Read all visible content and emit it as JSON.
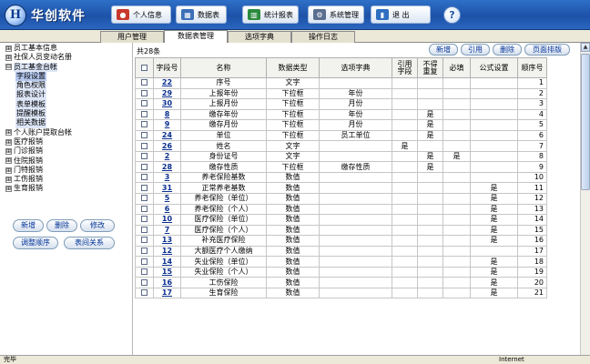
{
  "app": {
    "logo_char": "H",
    "name": "华创软件"
  },
  "header_buttons": [
    {
      "label": "个人信息",
      "icon": "person-icon"
    },
    {
      "label": "数据表",
      "icon": "table-icon"
    },
    {
      "label": "统计报表",
      "icon": "chart-icon"
    },
    {
      "label": "系统管理",
      "icon": "gear-icon"
    },
    {
      "label": "退 出",
      "icon": "exit-icon"
    }
  ],
  "help_label": "?",
  "tabs": [
    {
      "label": "用户管理",
      "active": false
    },
    {
      "label": "数据表管理",
      "active": true
    },
    {
      "label": "选项字典",
      "active": false
    },
    {
      "label": "操作日志",
      "active": false
    }
  ],
  "tree": [
    {
      "label": "员工基本信息",
      "expander": "⊞",
      "level": 0
    },
    {
      "label": "社保人员变动名册",
      "expander": "⊞",
      "level": 0
    },
    {
      "label": "员工基金台帐",
      "expander": "⊟",
      "level": 0
    },
    {
      "label": "字段设置",
      "level": 1,
      "selected": true
    },
    {
      "label": "角色权限",
      "level": 1
    },
    {
      "label": "报表设计",
      "level": 1
    },
    {
      "label": "表单模板",
      "level": 1
    },
    {
      "label": "提醒模板",
      "level": 1
    },
    {
      "label": "相关数据",
      "level": 1
    },
    {
      "label": "个人账户提取台帐",
      "expander": "⊞",
      "level": 0
    },
    {
      "label": "医疗报销",
      "expander": "⊞",
      "level": 0
    },
    {
      "label": "门诊报销",
      "expander": "⊞",
      "level": 0
    },
    {
      "label": "住院报销",
      "expander": "⊞",
      "level": 0
    },
    {
      "label": "门特报销",
      "expander": "⊞",
      "level": 0
    },
    {
      "label": "工伤报销",
      "expander": "⊞",
      "level": 0
    },
    {
      "label": "生育报销",
      "expander": "⊞",
      "level": 0
    }
  ],
  "sidebar_buttons": {
    "add": "新增",
    "delete": "删除",
    "edit": "修改",
    "reorder": "调整顺序",
    "relations": "表间关系"
  },
  "main": {
    "count_text": "共28条",
    "actions": {
      "add": "新增",
      "reference": "引用",
      "delete": "删除",
      "sort": "页面排版"
    },
    "columns": [
      "",
      "字段号",
      "名称",
      "数据类型",
      "选项字典",
      "引用\n字段",
      "不得\n重复",
      "必填",
      "公式设置",
      "顺序号"
    ],
    "rows": [
      {
        "id": "22",
        "name": "序号",
        "type": "文字",
        "dict": "",
        "ref": "",
        "unique": "",
        "req": "",
        "formula": "",
        "order": "1"
      },
      {
        "id": "29",
        "name": "上报年份",
        "type": "下拉框",
        "dict": "年份",
        "ref": "",
        "unique": "",
        "req": "",
        "formula": "",
        "order": "2"
      },
      {
        "id": "30",
        "name": "上报月份",
        "type": "下拉框",
        "dict": "月份",
        "ref": "",
        "unique": "",
        "req": "",
        "formula": "",
        "order": "3"
      },
      {
        "id": "8",
        "name": "缴存年份",
        "type": "下拉框",
        "dict": "年份",
        "ref": "",
        "unique": "是",
        "req": "",
        "formula": "",
        "order": "4"
      },
      {
        "id": "9",
        "name": "缴存月份",
        "type": "下拉框",
        "dict": "月份",
        "ref": "",
        "unique": "是",
        "req": "",
        "formula": "",
        "order": "5"
      },
      {
        "id": "24",
        "name": "单位",
        "type": "下拉框",
        "dict": "员工单位",
        "ref": "",
        "unique": "是",
        "req": "",
        "formula": "",
        "order": "6"
      },
      {
        "id": "26",
        "name": "姓名",
        "type": "文字",
        "dict": "",
        "ref": "是",
        "unique": "",
        "req": "",
        "formula": "",
        "order": "7"
      },
      {
        "id": "2",
        "name": "身份证号",
        "type": "文字",
        "dict": "",
        "ref": "",
        "unique": "是",
        "req": "是",
        "formula": "",
        "order": "8"
      },
      {
        "id": "28",
        "name": "缴存性质",
        "type": "下拉框",
        "dict": "缴存性质",
        "ref": "",
        "unique": "是",
        "req": "",
        "formula": "",
        "order": "9"
      },
      {
        "id": "3",
        "name": "养老保险基数",
        "type": "数值",
        "dict": "",
        "ref": "",
        "unique": "",
        "req": "",
        "formula": "",
        "order": "10"
      },
      {
        "id": "31",
        "name": "正常养老基数",
        "type": "数值",
        "dict": "",
        "ref": "",
        "unique": "",
        "req": "",
        "formula": "是",
        "order": "11"
      },
      {
        "id": "5",
        "name": "养老保险（单位）",
        "type": "数值",
        "dict": "",
        "ref": "",
        "unique": "",
        "req": "",
        "formula": "是",
        "order": "12"
      },
      {
        "id": "6",
        "name": "养老保险（个人）",
        "type": "数值",
        "dict": "",
        "ref": "",
        "unique": "",
        "req": "",
        "formula": "是",
        "order": "13"
      },
      {
        "id": "10",
        "name": "医疗保险（单位）",
        "type": "数值",
        "dict": "",
        "ref": "",
        "unique": "",
        "req": "",
        "formula": "是",
        "order": "14"
      },
      {
        "id": "7",
        "name": "医疗保险（个人）",
        "type": "数值",
        "dict": "",
        "ref": "",
        "unique": "",
        "req": "",
        "formula": "是",
        "order": "15"
      },
      {
        "id": "13",
        "name": "补充医疗保险",
        "type": "数值",
        "dict": "",
        "ref": "",
        "unique": "",
        "req": "",
        "formula": "是",
        "order": "16"
      },
      {
        "id": "12",
        "name": "大额医疗个人缴纳",
        "type": "数值",
        "dict": "",
        "ref": "",
        "unique": "",
        "req": "",
        "formula": "",
        "order": "17"
      },
      {
        "id": "14",
        "name": "失业保险（单位）",
        "type": "数值",
        "dict": "",
        "ref": "",
        "unique": "",
        "req": "",
        "formula": "是",
        "order": "18"
      },
      {
        "id": "15",
        "name": "失业保险（个人）",
        "type": "数值",
        "dict": "",
        "ref": "",
        "unique": "",
        "req": "",
        "formula": "是",
        "order": "19"
      },
      {
        "id": "16",
        "name": "工伤保险",
        "type": "数值",
        "dict": "",
        "ref": "",
        "unique": "",
        "req": "",
        "formula": "是",
        "order": "20"
      },
      {
        "id": "17",
        "name": "生育保险",
        "type": "数值",
        "dict": "",
        "ref": "",
        "unique": "",
        "req": "",
        "formula": "是",
        "order": "21"
      }
    ]
  },
  "status": {
    "left": "完毕",
    "right": "Internet"
  },
  "colors": {
    "header": "#1d52a8",
    "link": "#0b2f8f",
    "selected_tree": "#b4c7ee"
  }
}
